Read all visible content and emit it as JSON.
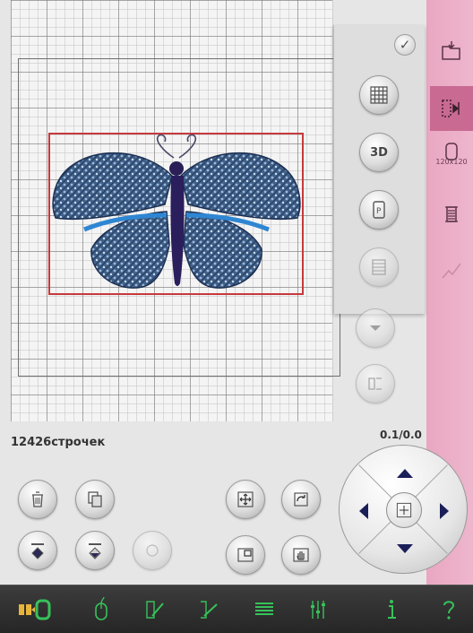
{
  "status": {
    "stitch_count_text": "12426строчек",
    "position_readout": "0.1/0.0"
  },
  "right_bar": {
    "hoop_size_label": "120x120"
  },
  "popup": {
    "confirm_icon": "check-icon",
    "buttons": [
      {
        "icon": "grid-icon"
      },
      {
        "label": "3D"
      },
      {
        "icon": "page-p-icon"
      },
      {
        "icon": "hatch-icon"
      }
    ]
  },
  "colors": {
    "nav_bar": "#2f2f2f",
    "right_bar": "#eab0c8",
    "right_bar_active": "#c96a92",
    "design_frame": "#c6393b",
    "accent_green": "#37c25a",
    "dpad_arrows": "#1a1f5a"
  }
}
